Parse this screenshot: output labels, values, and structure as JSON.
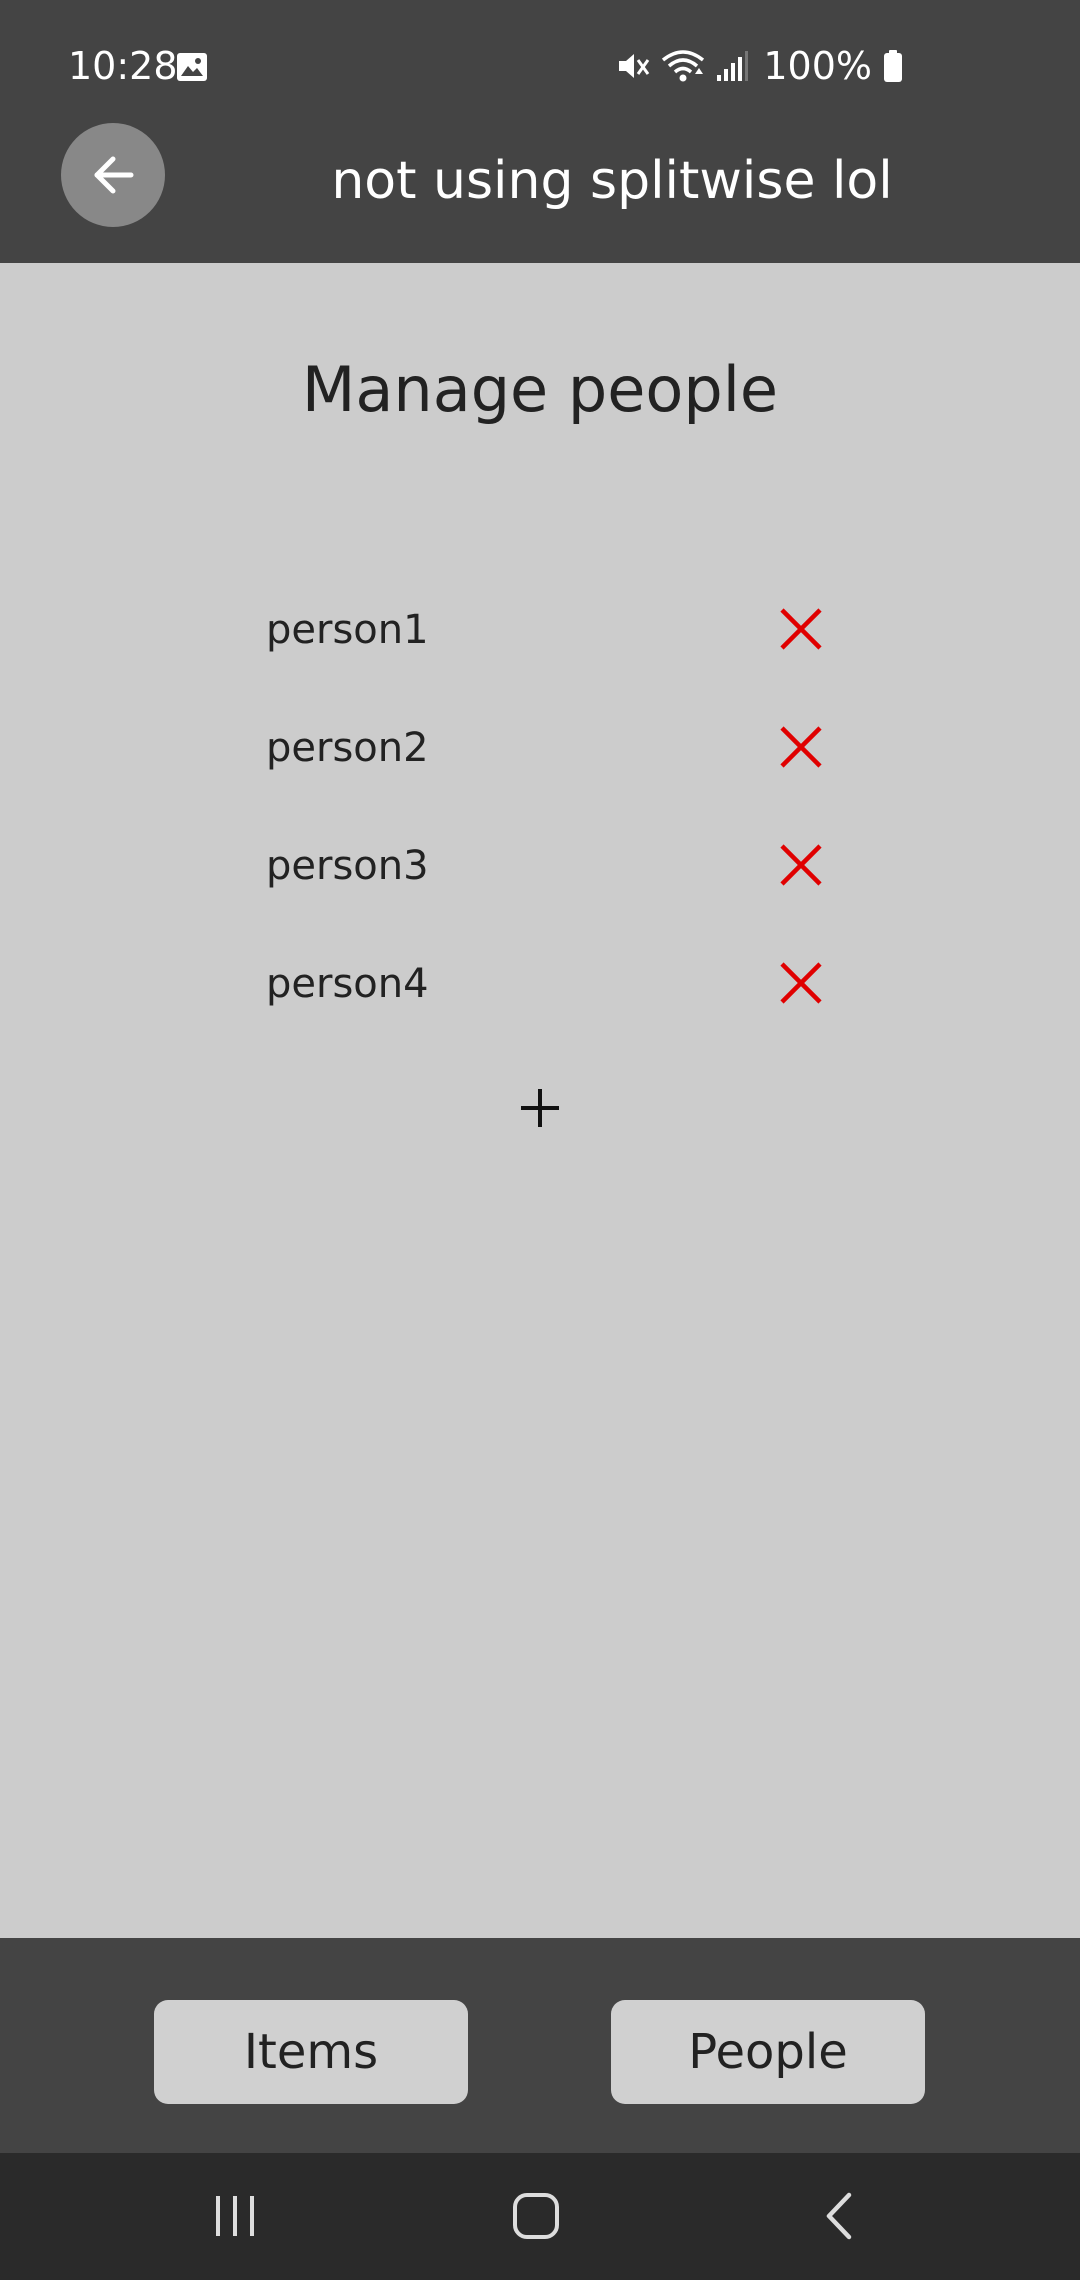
{
  "status_bar": {
    "time": "10:28",
    "battery": "100%",
    "icons": [
      "image-icon",
      "mute-icon",
      "wifi-icon",
      "signal-icon",
      "battery-icon"
    ]
  },
  "app_bar": {
    "title": "not using splitwise lol",
    "back_icon": "arrow-left-icon"
  },
  "main": {
    "title": "Manage people",
    "people": [
      {
        "name": "person1"
      },
      {
        "name": "person2"
      },
      {
        "name": "person3"
      },
      {
        "name": "person4"
      }
    ],
    "remove_icon": "close-icon",
    "add_icon": "plus-icon"
  },
  "bottom_tabs": {
    "items_label": "Items",
    "people_label": "People"
  },
  "nav_bar": {
    "buttons": [
      "recents-icon",
      "home-icon",
      "back-icon"
    ]
  },
  "colors": {
    "bar_background": "#444444",
    "content_background": "#cccccc",
    "remove_red": "#e00000",
    "back_button_bg": "#888888",
    "nav_background": "#2a2a2a"
  }
}
